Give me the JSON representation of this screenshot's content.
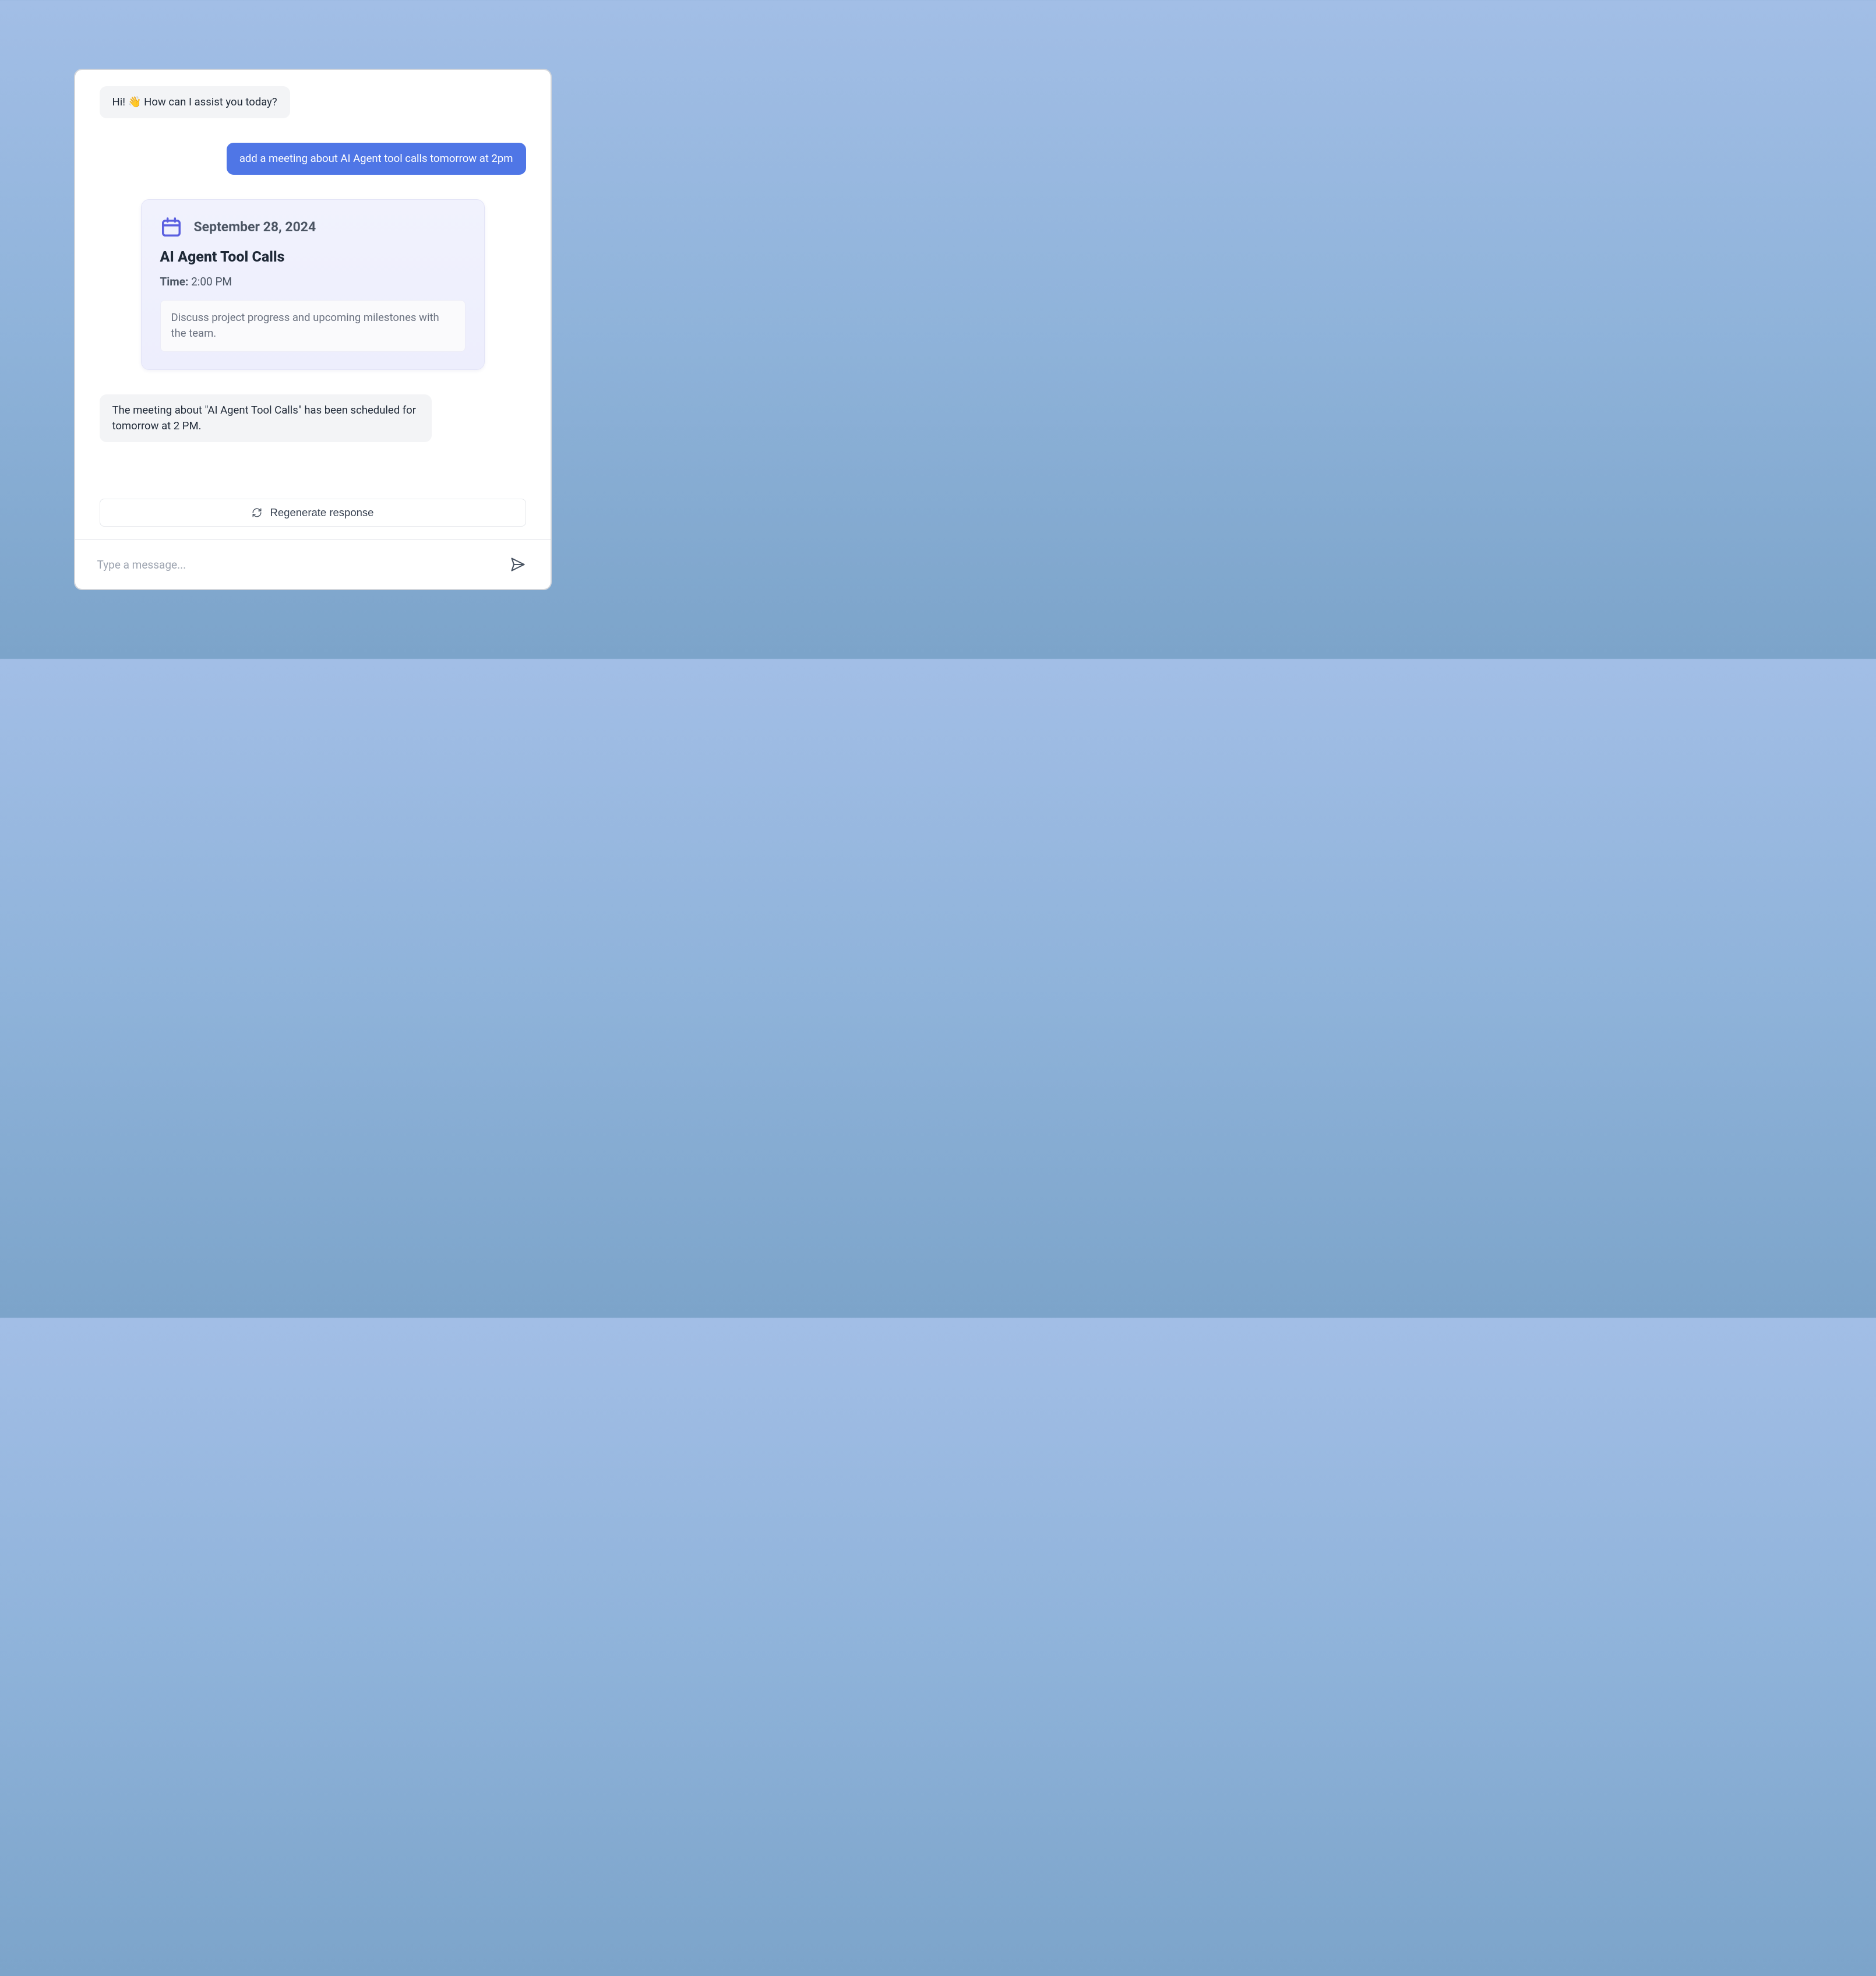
{
  "messages": {
    "greeting": "Hi! 👋 How can I assist you today?",
    "user_request": "add a meeting about AI Agent tool calls tomorrow at 2pm",
    "confirmation": "The meeting about \"AI Agent Tool Calls\" has been scheduled for tomorrow at 2 PM."
  },
  "event": {
    "date": "September 28, 2024",
    "title": "AI Agent Tool Calls",
    "time_label": "Time:",
    "time_value": "2:00 PM",
    "description": "Discuss project progress and upcoming milestones with the team."
  },
  "actions": {
    "regenerate_label": "Regenerate response"
  },
  "input": {
    "placeholder": "Type a message..."
  },
  "icons": {
    "calendar_color": "#5a5fe0",
    "send_color": "#4b5563",
    "refresh_color": "#4b5563"
  }
}
